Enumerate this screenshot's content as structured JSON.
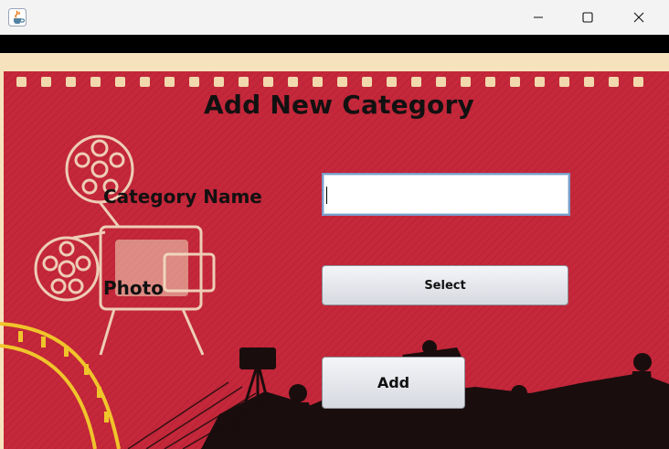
{
  "window": {
    "app_icon": "java-cup-icon",
    "controls": [
      "minimize-icon",
      "maximize-icon",
      "close-icon"
    ]
  },
  "form": {
    "title": "Add New Category",
    "category_name_label": "Category Name",
    "category_name_value": "",
    "photo_label": "Photo",
    "select_button": "Select",
    "add_button": "Add"
  },
  "colors": {
    "background_red": "#c4283a",
    "film_border": "#f6e3bd",
    "silhouette": "#1a0d0d",
    "input_border": "#7a9cc8"
  }
}
